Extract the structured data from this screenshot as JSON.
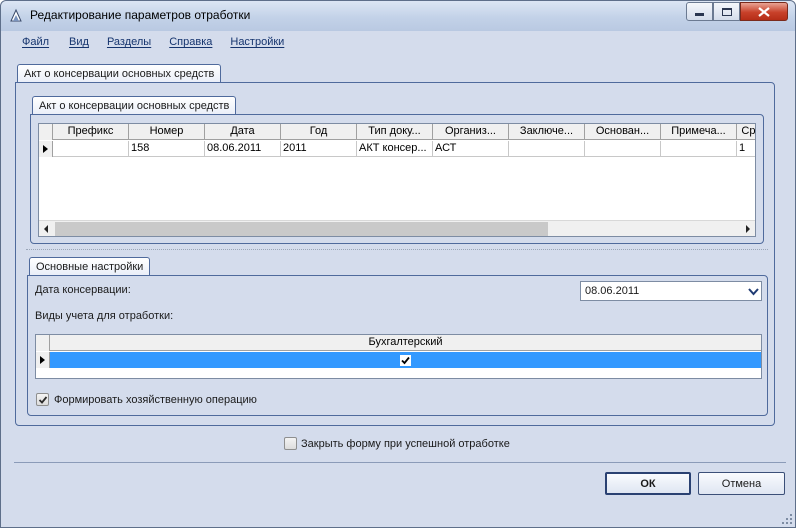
{
  "window": {
    "title": "Редактирование параметров отработки"
  },
  "menu": [
    "Файл",
    "Вид",
    "Разделы",
    "Справка",
    "Настройки"
  ],
  "outer_tab": "Акт о консервации основных средств",
  "grid_section": {
    "tab": "Акт о консервации основных средств",
    "columns": [
      "Префикс",
      "Номер",
      "Дата",
      "Год",
      "Тип доку...",
      "Организ...",
      "Заключе...",
      "Основан...",
      "Примеча...",
      "Сро"
    ],
    "rows": [
      [
        "",
        "158",
        "08.06.2011",
        "2011",
        "АКТ консер...",
        "АСТ",
        "",
        "",
        "",
        "1"
      ]
    ]
  },
  "settings": {
    "tab": "Основные настройки",
    "date_label": "Дата консервации:",
    "date_value": "08.06.2011",
    "accounting_label": "Виды учета для отработки:",
    "accounting_grid": {
      "column": "Бухгалтерский",
      "checked": true
    },
    "form_operation_label": "Формировать хозяйственную операцию",
    "form_operation_checked": true
  },
  "close_on_success_label": "Закрыть форму при успешной отработке",
  "close_on_success_checked": false,
  "buttons": {
    "ok": "ОК",
    "cancel": "Отмена"
  },
  "colors": {
    "frame": "#d4dcec",
    "selection": "#3399ff",
    "accent_border": "#4f6a9c"
  }
}
